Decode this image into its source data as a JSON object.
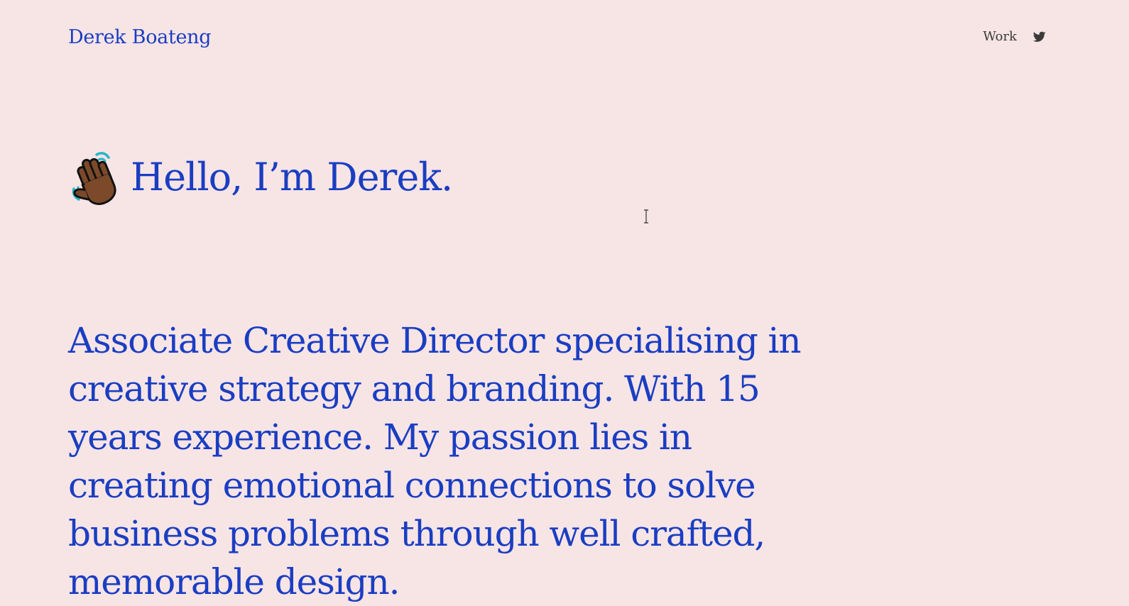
{
  "header": {
    "brand": "Derek Boateng",
    "nav": {
      "work_label": "Work",
      "twitter_icon": "twitter-icon"
    }
  },
  "hero": {
    "emoji_icon": "waving-hand-icon",
    "greeting": "Hello, I’m Derek."
  },
  "intro": {
    "text": "Associate Creative Director specialising in creative strategy and branding. With 15 years experience. My passion lies in creating emotional connections to solve business problems through well crafted, memorable design."
  },
  "colors": {
    "background": "#f7e4e5",
    "accent": "#1a3ec2",
    "nav_text": "#3a3a3a"
  }
}
